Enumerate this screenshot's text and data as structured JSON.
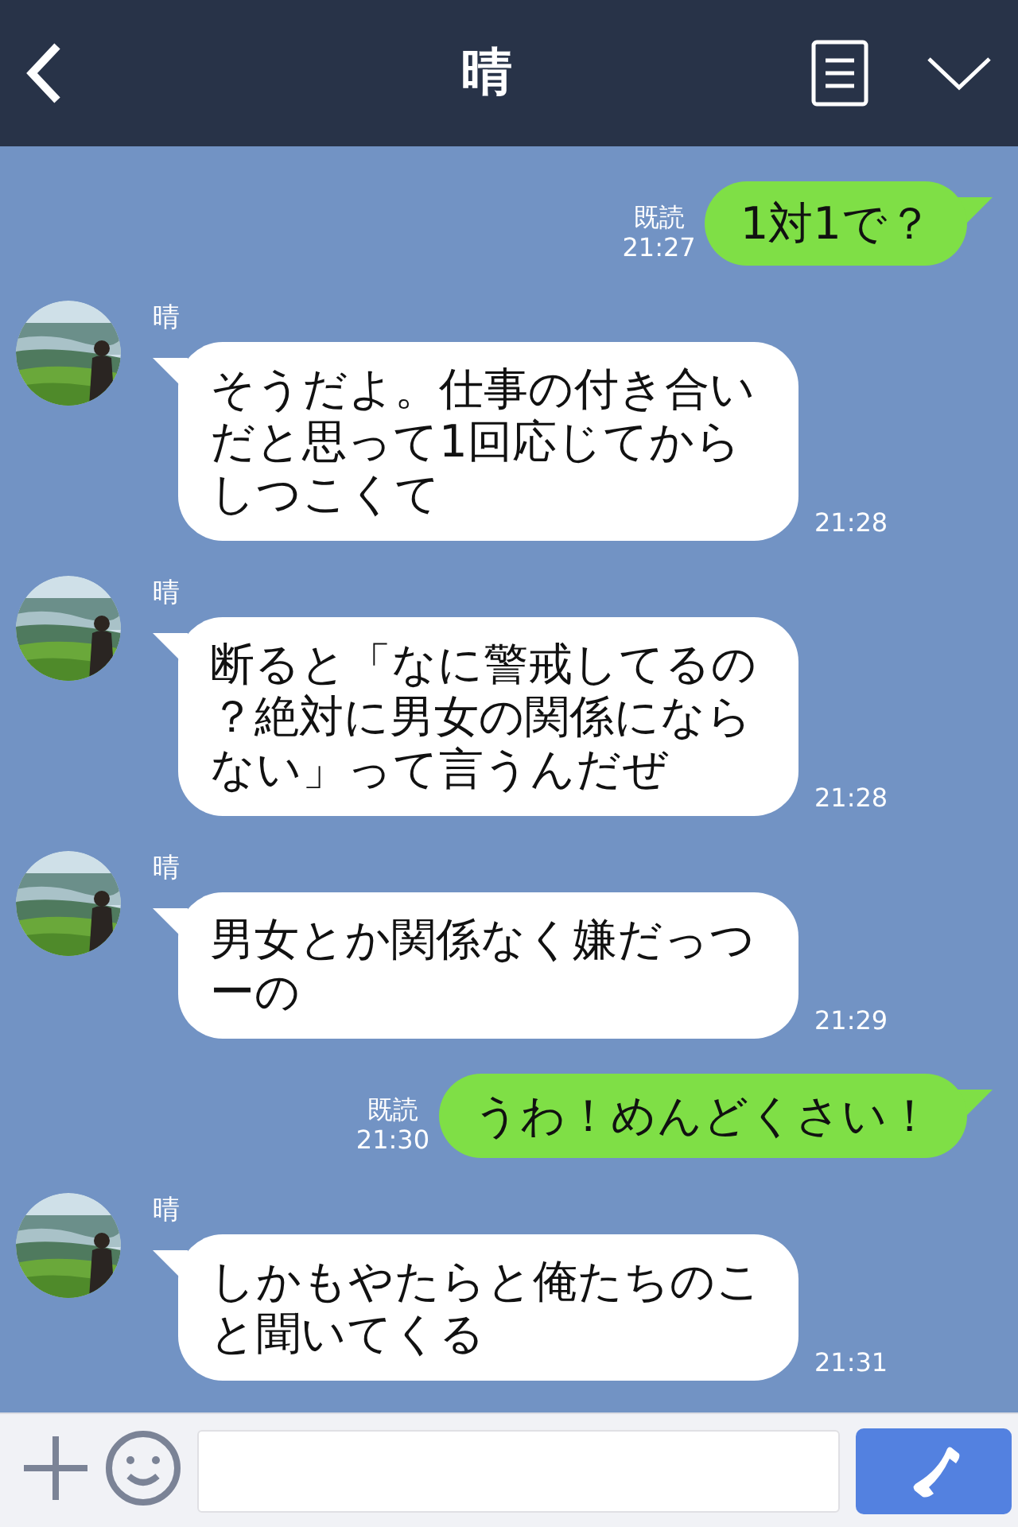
{
  "header": {
    "title": "晴"
  },
  "messages": [
    {
      "kind": "sent",
      "read": "既読",
      "time": "21:27",
      "text": "1対1で？"
    },
    {
      "kind": "received",
      "name": "晴",
      "text": "そうだよ。仕事の付き合いだと思って1回応じてからしつこくて",
      "time": "21:28"
    },
    {
      "kind": "received",
      "name": "晴",
      "text": "断ると「なに警戒してるの？絶対に男女の関係にならない」って言うんだぜ",
      "time": "21:28"
    },
    {
      "kind": "received",
      "name": "晴",
      "text": "男女とか関係なく嫌だっつーの",
      "time": "21:29"
    },
    {
      "kind": "sent",
      "read": "既読",
      "time": "21:30",
      "text": "うわ！めんどくさい！"
    },
    {
      "kind": "received",
      "name": "晴",
      "text": "しかもやたらと俺たちのこと聞いてくる",
      "time": "21:31"
    }
  ]
}
